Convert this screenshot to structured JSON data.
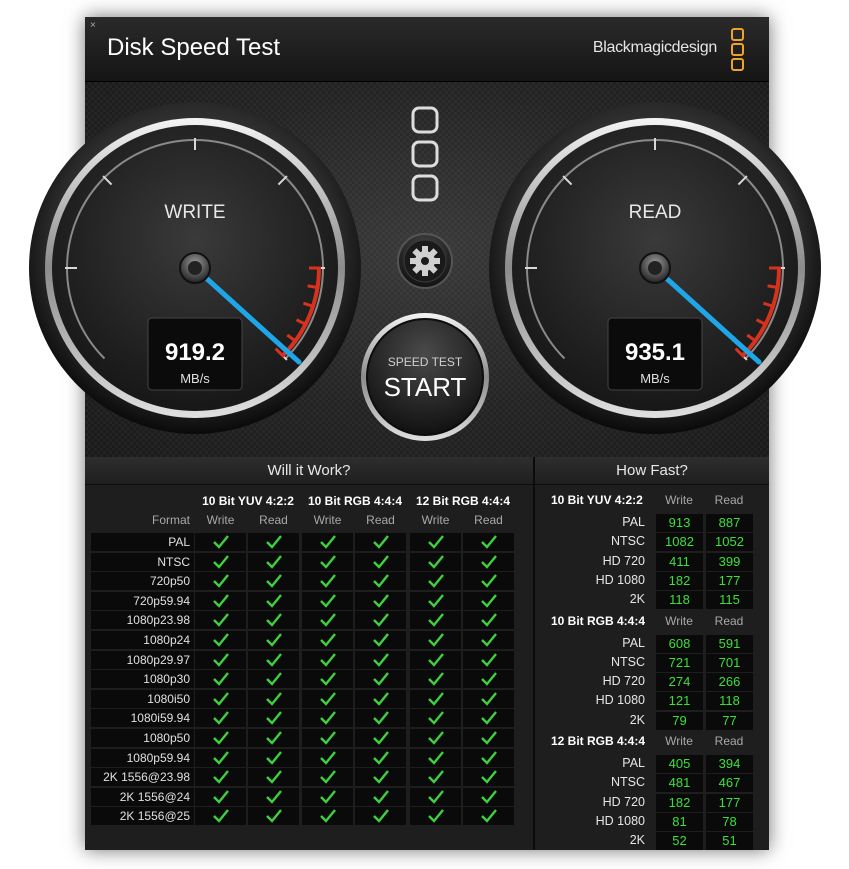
{
  "window": {
    "title": "Disk Speed Test",
    "brand": "Blackmagicdesign",
    "close_glyph": "×"
  },
  "gauges": {
    "write": {
      "label": "WRITE",
      "value": "919.2",
      "unit": "MB/s"
    },
    "read": {
      "label": "READ",
      "value": "935.1",
      "unit": "MB/s"
    }
  },
  "start_button": {
    "caption": "SPEED TEST",
    "label": "START"
  },
  "settings_icon": "gear-icon",
  "will_it_work": {
    "title": "Will it Work?",
    "format_header": "Format",
    "groups": [
      "10 Bit YUV 4:2:2",
      "10 Bit RGB 4:4:4",
      "12 Bit RGB 4:4:4"
    ],
    "sub_write": "Write",
    "sub_read": "Read",
    "formats": [
      "PAL",
      "NTSC",
      "720p50",
      "720p59.94",
      "1080p23.98",
      "1080p24",
      "1080p29.97",
      "1080p30",
      "1080i50",
      "1080i59.94",
      "1080p50",
      "1080p59.94",
      "2K 1556@23.98",
      "2K 1556@24",
      "2K 1556@25"
    ],
    "check_color": "#3fd03f"
  },
  "how_fast": {
    "title": "How Fast?",
    "sub_write": "Write",
    "sub_read": "Read",
    "groups": [
      {
        "name": "10 Bit YUV 4:2:2",
        "rows": [
          {
            "label": "PAL",
            "write": "913",
            "read": "887"
          },
          {
            "label": "NTSC",
            "write": "1082",
            "read": "1052"
          },
          {
            "label": "HD 720",
            "write": "411",
            "read": "399"
          },
          {
            "label": "HD 1080",
            "write": "182",
            "read": "177"
          },
          {
            "label": "2K",
            "write": "118",
            "read": "115"
          }
        ]
      },
      {
        "name": "10 Bit RGB 4:4:4",
        "rows": [
          {
            "label": "PAL",
            "write": "608",
            "read": "591"
          },
          {
            "label": "NTSC",
            "write": "721",
            "read": "701"
          },
          {
            "label": "HD 720",
            "write": "274",
            "read": "266"
          },
          {
            "label": "HD 1080",
            "write": "121",
            "read": "118"
          },
          {
            "label": "2K",
            "write": "79",
            "read": "77"
          }
        ]
      },
      {
        "name": "12 Bit RGB 4:4:4",
        "rows": [
          {
            "label": "PAL",
            "write": "405",
            "read": "394"
          },
          {
            "label": "NTSC",
            "write": "481",
            "read": "467"
          },
          {
            "label": "HD 720",
            "write": "182",
            "read": "177"
          },
          {
            "label": "HD 1080",
            "write": "81",
            "read": "78"
          },
          {
            "label": "2K",
            "write": "52",
            "read": "51"
          }
        ]
      }
    ],
    "value_color": "#3be03b"
  },
  "colors": {
    "needle": "#1fa6e8",
    "redline": "#d8321e",
    "brand_orange": "#f0a12b"
  }
}
